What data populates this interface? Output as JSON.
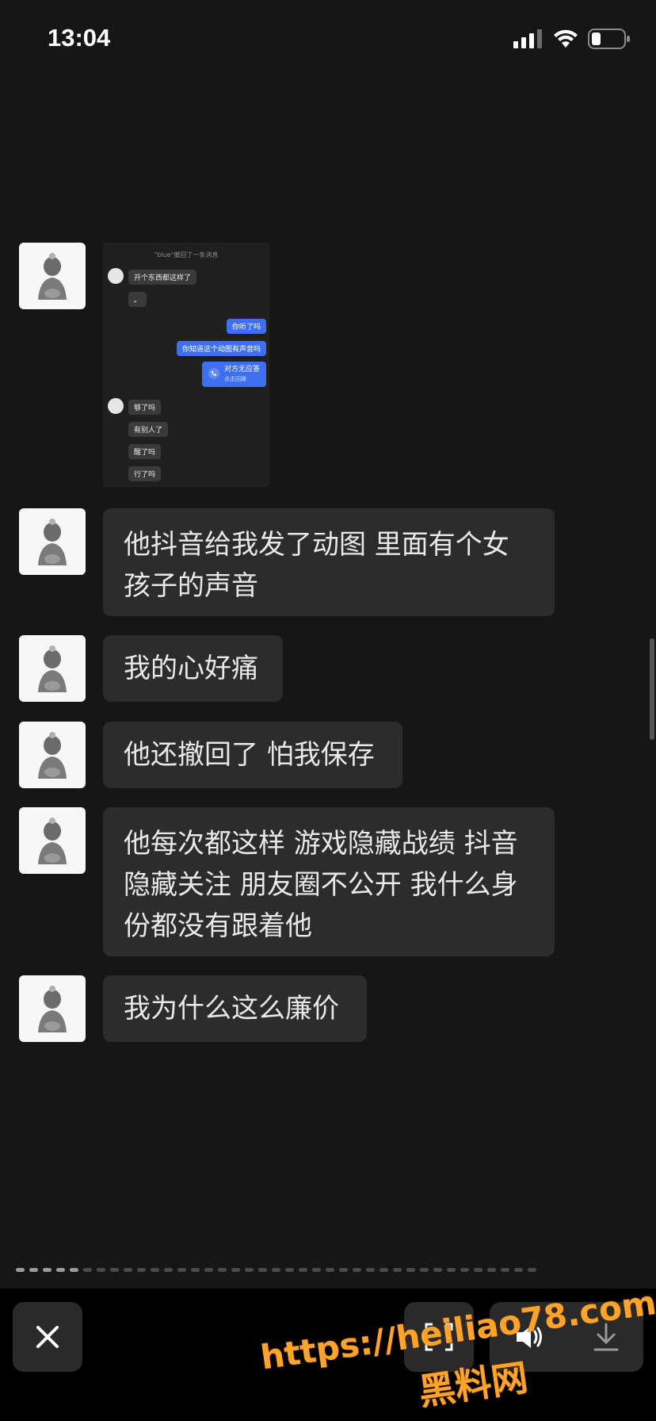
{
  "status": {
    "time": "13:04"
  },
  "embedded_screenshot": {
    "header": "\"blue\"撤回了一条消息",
    "messages": [
      {
        "side": "in",
        "text": "开个东西都这样了"
      },
      {
        "side": "in",
        "text": "。"
      },
      {
        "side": "out",
        "text": "你听了吗"
      },
      {
        "side": "out",
        "text": "你知道这个动图有声音吗"
      },
      {
        "side": "out-call",
        "text": "对方无应答",
        "sub": "点击回拨"
      },
      {
        "side": "in",
        "text": "够了吗"
      },
      {
        "side": "in",
        "text": "有别人了"
      },
      {
        "side": "in",
        "text": "醒了吗"
      },
      {
        "side": "in",
        "text": "行了吗"
      }
    ]
  },
  "messages": [
    {
      "lines": [
        "他抖音给我发了动图 里面有个女",
        "孩子的声音"
      ]
    },
    {
      "lines": [
        "我的心好痛"
      ]
    },
    {
      "lines": [
        "他还撤回了 怕我保存"
      ]
    },
    {
      "lines": [
        "他每次都这样 游戏隐藏战绩 抖音",
        "隐藏关注 朋友圈不公开 我什么身",
        "份都没有跟着他"
      ]
    },
    {
      "lines": [
        "我为什么这么廉价"
      ]
    }
  ],
  "page_dots": {
    "total": 39,
    "active": 5
  },
  "bottom_bar": {
    "close_icon": "close-icon",
    "buttons": [
      "scan-icon",
      "speaker-icon",
      "download-icon"
    ]
  },
  "watermark": {
    "url": "https://heiliao78.com",
    "name": "黑料网"
  },
  "colors": {
    "background": "#161616",
    "bubble": "#2c2c2c",
    "accent_blue": "#3d6ff0",
    "watermark": "#ffa42b"
  }
}
